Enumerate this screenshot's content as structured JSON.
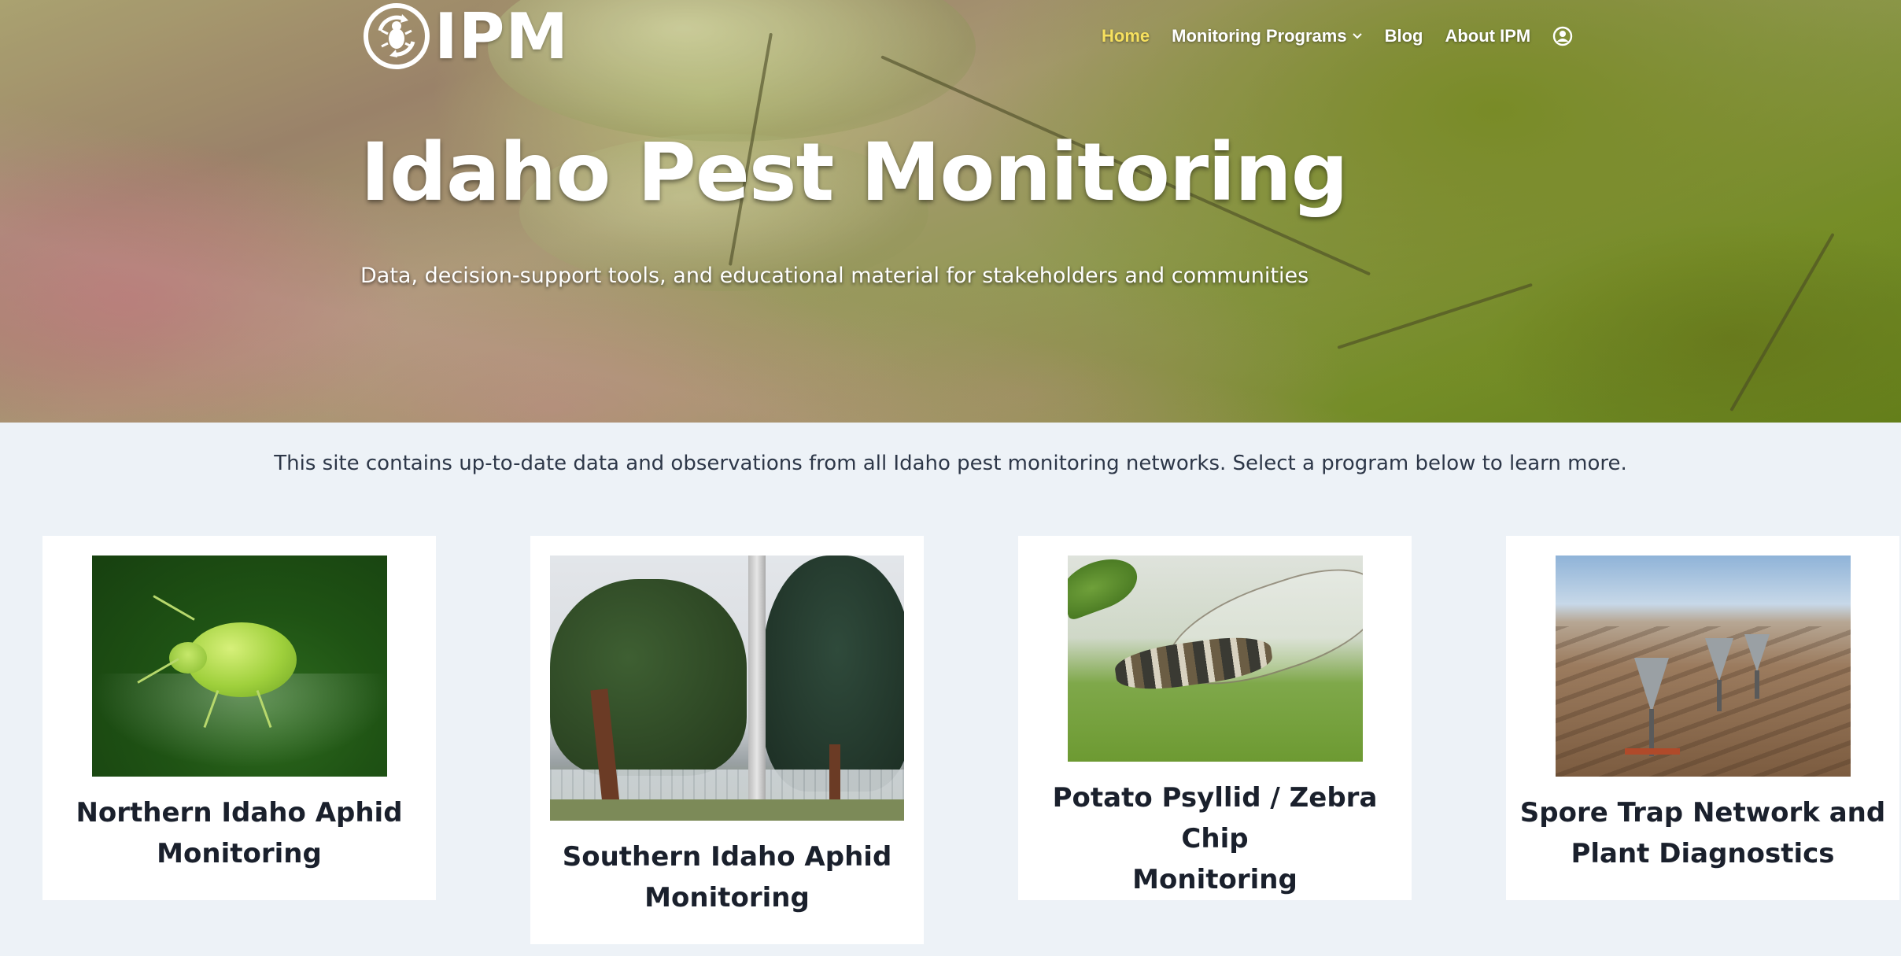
{
  "brand": {
    "logo_text": "IPM",
    "logo_icon": "aphid-recycle-badge-icon"
  },
  "nav": {
    "items": [
      {
        "label": "Home",
        "active": true
      },
      {
        "label": "Monitoring Programs",
        "has_dropdown": true
      },
      {
        "label": "Blog"
      },
      {
        "label": "About IPM"
      }
    ],
    "account_icon": "user-circle-icon",
    "active_color": "#f6e05e"
  },
  "hero": {
    "title": "Idaho Pest Monitoring",
    "subtitle": "Data, decision-support tools, and educational material for stakeholders and communities"
  },
  "intro": "This site contains up-to-date data and observations from all Idaho pest monitoring networks. Select a program below to learn more.",
  "programs": [
    {
      "title_line1": "Northern Idaho Aphid",
      "title_line2": "Monitoring",
      "image": "green aphid on leaf"
    },
    {
      "title_line1": "Southern Idaho Aphid",
      "title_line2": "Monitoring",
      "image": "trees and pole"
    },
    {
      "title_line1": "Potato Psyllid / Zebra Chip",
      "title_line2": "Monitoring",
      "image": "psyllid insect on leaf"
    },
    {
      "title_line1": "Spore Trap Network and",
      "title_line2": "Plant Diagnostics",
      "image": "spore traps in field"
    }
  ],
  "colors": {
    "page_bg": "#edf2f7",
    "card_bg": "#ffffff",
    "text": "#1a202c"
  }
}
